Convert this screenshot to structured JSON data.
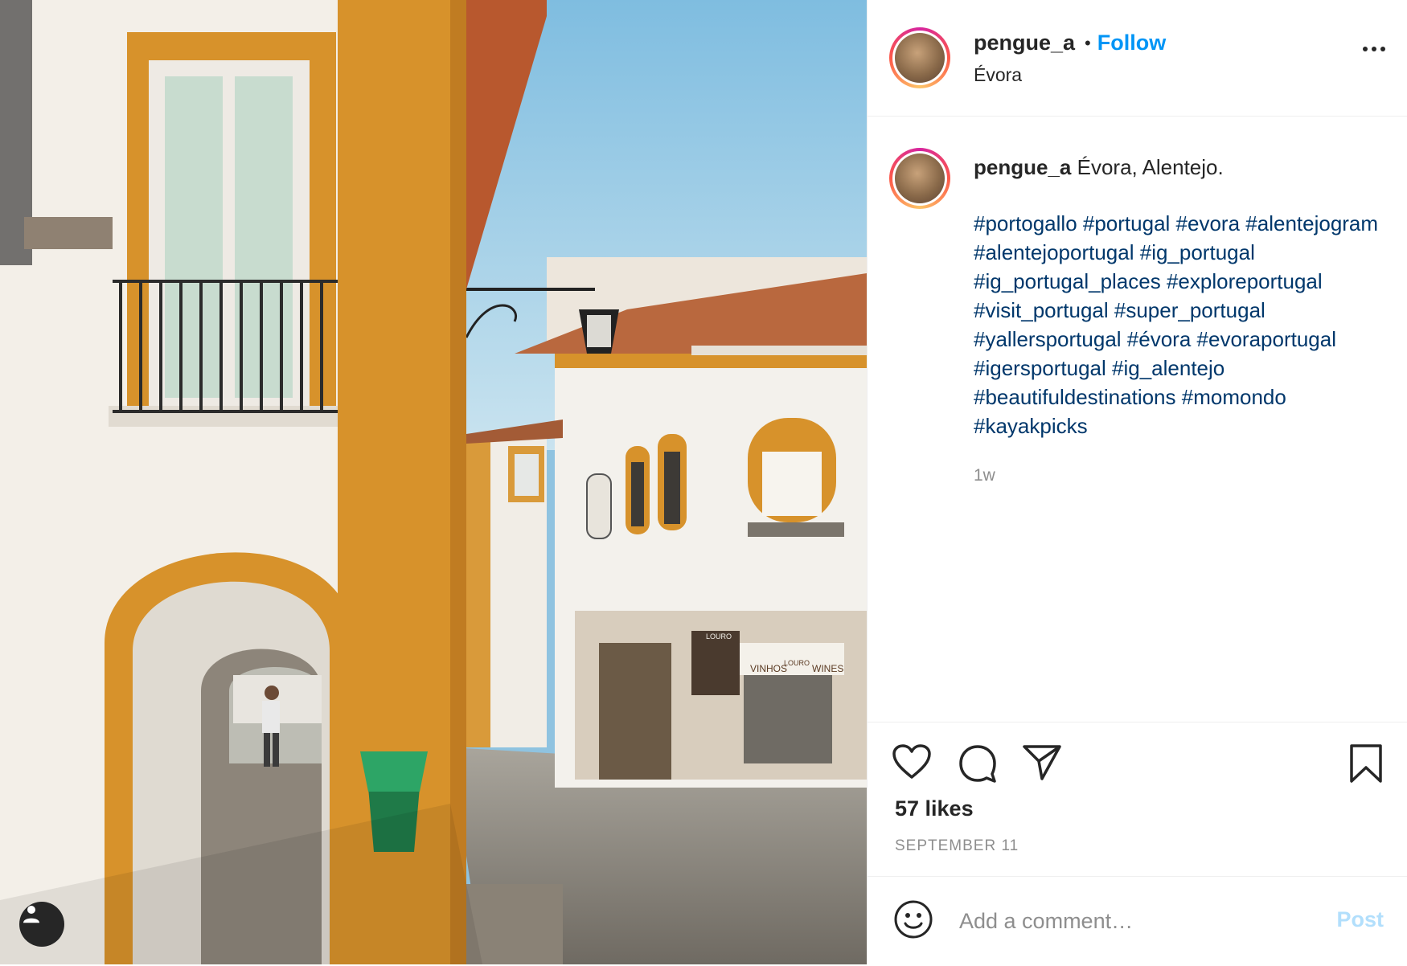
{
  "post": {
    "username": "pengue_a",
    "follow_label": "Follow",
    "dot": "•",
    "location": "Évora"
  },
  "caption": {
    "username": "pengue_a",
    "text": "Évora, Alentejo.",
    "hashtags": [
      "#portogallo",
      "#portugal",
      "#evora",
      "#alentejogram",
      "#alentejoportugal",
      "#ig_portugal",
      "#ig_portugal_places",
      "#exploreportugal",
      "#visit_portugal",
      "#super_portugal",
      "#yallersportugal",
      "#évora",
      "#evoraportugal",
      "#igersportugal",
      "#ig_alentejo",
      "#beautifuldestinations",
      "#momondo",
      "#kayakpicks"
    ],
    "time": "1w"
  },
  "engagement": {
    "likes": "57 likes",
    "date": "SEPTEMBER 11"
  },
  "comment": {
    "placeholder": "Add a comment…",
    "post_label": "Post"
  },
  "photo": {
    "shop_sign_1": "VINHOS",
    "shop_sign_2": "LOURO",
    "shop_sign_3": "WINES",
    "shop_plaque": "LOURO"
  },
  "colors": {
    "follow": "#0095f6",
    "hashtag": "#00376b",
    "post_disabled": "#b2dffc",
    "ochre": "#d7922b"
  },
  "icons": [
    "heart-icon",
    "comment-icon",
    "share-icon",
    "bookmark-icon",
    "emoji-icon",
    "more-icon",
    "user-tag-icon"
  ]
}
